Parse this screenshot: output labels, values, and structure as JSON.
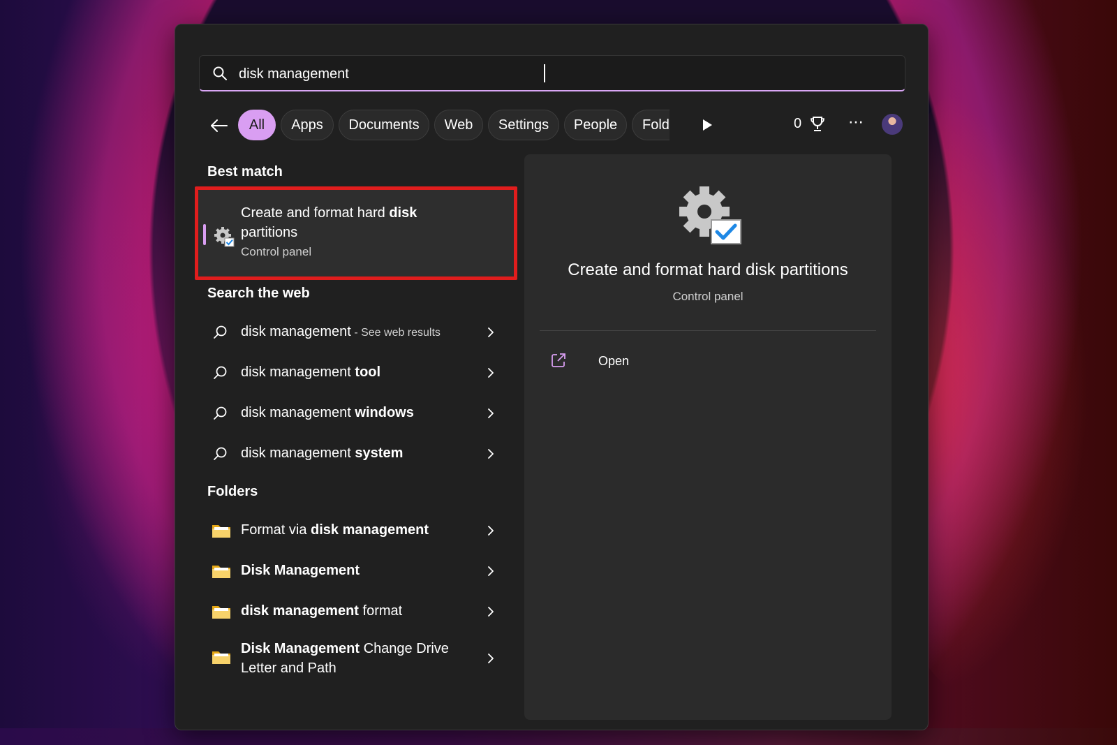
{
  "search": {
    "value": "disk management",
    "placeholder": ""
  },
  "filters": {
    "chips": [
      "All",
      "Apps",
      "Documents",
      "Web",
      "Settings",
      "People",
      "Fold"
    ],
    "active": "All",
    "points": "0"
  },
  "best_match": {
    "section_title": "Best match",
    "title_pre": "Create and format hard ",
    "title_bold": "disk",
    "title_post": "partitions",
    "subtitle": "Control panel"
  },
  "web": {
    "section_title": "Search the web",
    "items": [
      {
        "pre": "disk management",
        "bold": "",
        "suffix": " - See web results"
      },
      {
        "pre": "disk management ",
        "bold": "tool",
        "suffix": ""
      },
      {
        "pre": "disk management ",
        "bold": "windows",
        "suffix": ""
      },
      {
        "pre": "disk management ",
        "bold": "system",
        "suffix": ""
      }
    ]
  },
  "folders": {
    "section_title": "Folders",
    "items": [
      {
        "pre": "Format via ",
        "bold": "disk management",
        "post": ""
      },
      {
        "pre": "",
        "bold": "Disk Management",
        "post": ""
      },
      {
        "pre": "",
        "bold": "disk management",
        "post": " format"
      },
      {
        "pre": "",
        "bold": "Disk Management",
        "post": " Change Drive Letter and Path"
      }
    ]
  },
  "detail": {
    "title": "Create and format hard disk partitions",
    "subtitle": "Control panel",
    "action_open": "Open"
  },
  "colors": {
    "accent": "#d99ef2",
    "highlight": "#e01d1d",
    "panel": "#202020",
    "folder": "#f2c94c"
  },
  "icons": {
    "search": "search-icon",
    "back": "arrow-left-icon",
    "play": "play-icon",
    "trophy": "trophy-icon",
    "more": "more-icon",
    "settings": "gear-check-icon",
    "chevron": "chevron-right-icon",
    "folder": "folder-icon",
    "open": "open-external-icon"
  }
}
